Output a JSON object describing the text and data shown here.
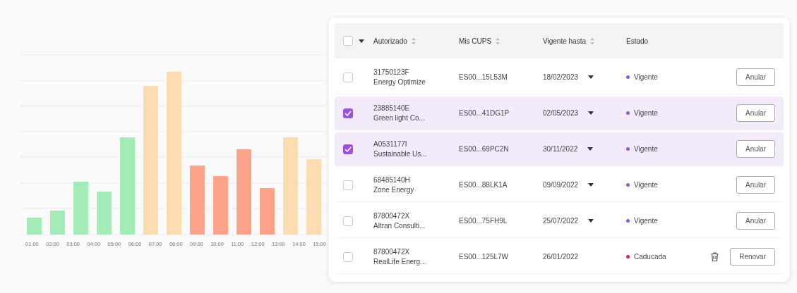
{
  "chart": {
    "x_labels": [
      "01:00",
      "02:00",
      "03:00",
      "04:00",
      "05:00",
      "06:00",
      "07:00",
      "08:00",
      "09:00",
      "10:00",
      "11:00",
      "12:00",
      "13:00",
      "14:00",
      "15:00"
    ]
  },
  "table": {
    "header_checkbox": {
      "checked": false
    },
    "columns": [
      {
        "label": "Autorizado",
        "sortable": true
      },
      {
        "label": "Mis CUPS",
        "sortable": true
      },
      {
        "label": "Vigente hasta",
        "sortable": true
      },
      {
        "label": "Estado",
        "sortable": false
      }
    ],
    "rows": [
      {
        "selected": false,
        "id": "31750123F",
        "name": "Energy Optimize",
        "cups": "ES00...15L53M",
        "date": "18/02/2023",
        "date_dropdown": true,
        "status": "Vigente",
        "color": "#9b51e0",
        "deletable": false,
        "action": "Anular"
      },
      {
        "selected": true,
        "id": "23885140E",
        "name": "Green light Co...",
        "cups": "ES00...41DG1P",
        "date": "02/05/2023",
        "date_dropdown": true,
        "status": "Vigente",
        "color": "#9b51e0",
        "deletable": false,
        "action": "Anular"
      },
      {
        "selected": true,
        "id": "A0531177I",
        "name": "Sustainable Us...",
        "cups": "ES00...69PC2N",
        "date": "30/11/2022",
        "date_dropdown": true,
        "status": "Vigente",
        "color": "#9b51e0",
        "deletable": false,
        "action": "Anular"
      },
      {
        "selected": false,
        "id": "68485140H",
        "name": "Zone Energy",
        "cups": "ES00...88LK1A",
        "date": "09/09/2022",
        "date_dropdown": true,
        "status": "Vigente",
        "color": "#9b51e0",
        "deletable": false,
        "action": "Anular"
      },
      {
        "selected": false,
        "id": "87800472X",
        "name": "Altran Consulti...",
        "cups": "ES00...75FH9L",
        "date": "25/07/2022",
        "date_dropdown": true,
        "status": "Vigente",
        "color": "#9b51e0",
        "deletable": false,
        "action": "Anular"
      },
      {
        "selected": false,
        "id": "87800472X",
        "name": "RealLife Energ...",
        "cups": "ES00...125L7W",
        "date": "26/01/2022",
        "date_dropdown": false,
        "status": "Caducada",
        "color": "#e8175d",
        "deletable": true,
        "action": "Renovar"
      }
    ]
  }
}
